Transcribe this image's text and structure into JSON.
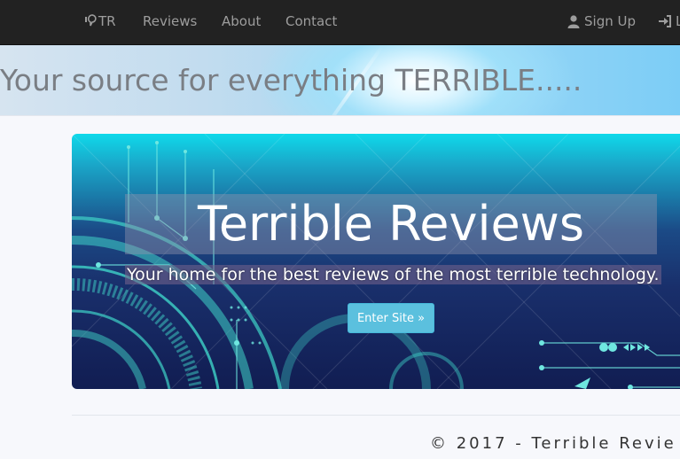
{
  "nav": {
    "brand": "TR",
    "items": [
      "Reviews",
      "About",
      "Contact"
    ],
    "signup": "Sign Up",
    "login": "L"
  },
  "hero": {
    "title": "Your source for everything TERRIBLE....."
  },
  "panel": {
    "title": "Terrible Reviews",
    "subtitle": "Your home for the best reviews of the most terrible technology.",
    "button": "Enter Site »"
  },
  "footer": {
    "text": "© 2017 - Terrible Revie"
  },
  "colors": {
    "navbar": "#222222",
    "nav_text": "#9d9d9d",
    "button": "#5bc0de"
  }
}
